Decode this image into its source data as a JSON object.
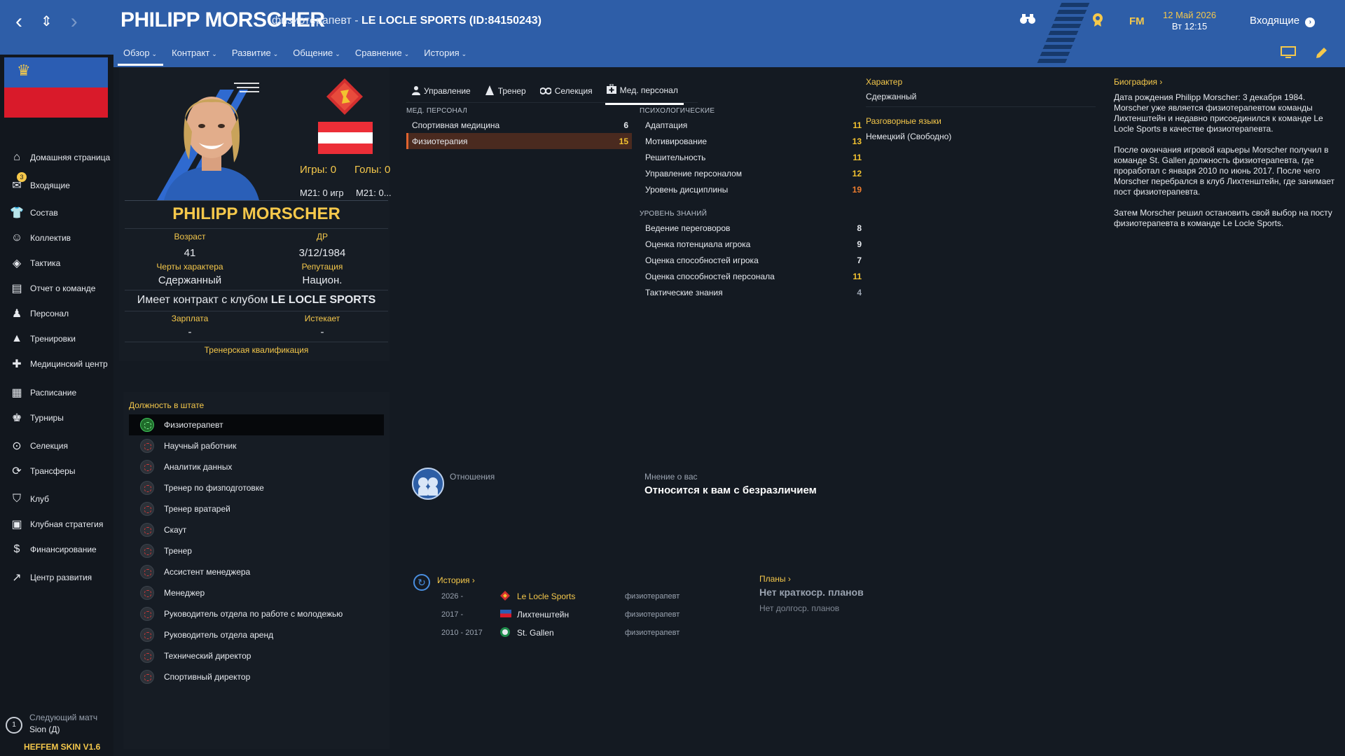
{
  "header": {
    "nav": {
      "back": "‹",
      "updown": "⇕",
      "forward": "›"
    },
    "title": "PHILIPP MORSCHER",
    "subtitle_prefix": "физиотерапевт - ",
    "subtitle_club": "LE LOCLE SPORTS (ID:84150243)",
    "tabs": [
      "Обзор",
      "Контракт",
      "Развитие",
      "Общение",
      "Сравнение",
      "История"
    ],
    "date_line1": "12 Май 2026",
    "date_line2": "Вт 12:15",
    "fm_label": "FM",
    "inbox_label": "Входящие"
  },
  "sidebar": {
    "inbox_badge": "3",
    "items": [
      {
        "label": "Домашняя страница",
        "icon": "home-icon"
      },
      {
        "label": "Входящие",
        "icon": "inbox-icon"
      },
      {
        "label": "Состав",
        "icon": "shirt-icon"
      },
      {
        "label": "Коллектив",
        "icon": "brain-icon"
      },
      {
        "label": "Тактика",
        "icon": "tactics-icon"
      },
      {
        "label": "Отчет о команде",
        "icon": "report-icon"
      },
      {
        "label": "Персонал",
        "icon": "staff-icon"
      },
      {
        "label": "Тренировки",
        "icon": "cone-icon"
      },
      {
        "label": "Медицинский центр",
        "icon": "medical-icon"
      },
      {
        "label": "Расписание",
        "icon": "calendar-icon"
      },
      {
        "label": "Турниры",
        "icon": "trophy-icon"
      },
      {
        "label": "Селекция",
        "icon": "binoculars-icon"
      },
      {
        "label": "Трансферы",
        "icon": "transfer-icon"
      },
      {
        "label": "Клуб",
        "icon": "shield-icon"
      },
      {
        "label": "Клубная стратегия",
        "icon": "briefcase-icon"
      },
      {
        "label": "Финансирование",
        "icon": "money-icon"
      },
      {
        "label": "Центр развития",
        "icon": "growth-icon"
      }
    ],
    "next_match_number": "1",
    "next_match_label": "Следующий матч",
    "next_match_opponent": "Sion (Д)",
    "skin_label": "HEFFEM SKIN V1.6"
  },
  "profile": {
    "games_label": "Игры: 0",
    "goals_label": "Голы: 0",
    "m1": "М21: 0 игр",
    "m2": "М21: 0...",
    "name": "PHILIPP MORSCHER",
    "age_label": "Возраст",
    "age": "41",
    "dob_label": "ДР",
    "dob": "3/12/1984",
    "traits_label": "Черты характера",
    "traits": "Сдержанный",
    "rep_label": "Репутация",
    "rep": "Национ.",
    "contract_prefix": "Имеет контракт с клубом ",
    "contract_club": "LE LOCLE SPORTS",
    "wage_label": "Зарплата",
    "wage": "-",
    "expires_label": "Истекает",
    "expires": "-",
    "coaching_qual": "Тренерская квалификация"
  },
  "staff_roles": {
    "title": "Должность в штате",
    "roles": [
      "Физиотерапевт",
      "Научный работник",
      "Аналитик данных",
      "Тренер по физподготовке",
      "Тренер вратарей",
      "Скаут",
      "Тренер",
      "Ассистент менеджера",
      "Менеджер",
      "Руководитель отдела по работе с молодежью",
      "Руководитель отдела аренд",
      "Технический директор",
      "Спортивный директор"
    ],
    "selected": 0
  },
  "subtabs": [
    "Управление",
    "Тренер",
    "Селекция",
    "Мед. персонал"
  ],
  "medical": {
    "title": "МЕД. ПЕРСОНАЛ",
    "attrs": [
      {
        "name": "Спортивная медицина",
        "value": "6",
        "color": "white"
      },
      {
        "name": "Физиотерапия",
        "value": "15",
        "color": "yellow",
        "highlight": true
      }
    ]
  },
  "psych": {
    "title": "ПСИХОЛОГИЧЕСКИЕ",
    "attrs": [
      {
        "name": "Адаптация",
        "value": "11",
        "color": "yellow"
      },
      {
        "name": "Мотивирование",
        "value": "13",
        "color": "yellow"
      },
      {
        "name": "Решительность",
        "value": "11",
        "color": "yellow"
      },
      {
        "name": "Управление персоналом",
        "value": "12",
        "color": "yellow"
      },
      {
        "name": "Уровень дисциплины",
        "value": "19",
        "color": "orange"
      }
    ]
  },
  "knowledge": {
    "title": "УРОВЕНЬ ЗНАНИЙ",
    "attrs": [
      {
        "name": "Ведение переговоров",
        "value": "8",
        "color": "white"
      },
      {
        "name": "Оценка потенциала игрока",
        "value": "9",
        "color": "white"
      },
      {
        "name": "Оценка способностей игрока",
        "value": "7",
        "color": "white"
      },
      {
        "name": "Оценка способностей персонала",
        "value": "11",
        "color": "yellow"
      },
      {
        "name": "Тактические знания",
        "value": "4",
        "color": "grey"
      }
    ]
  },
  "character": {
    "label": "Характер",
    "value": "Сдержанный",
    "languages_label": "Разговорные языки",
    "languages": "Немецкий (Свободно)"
  },
  "relations": {
    "label": "Отношения",
    "opinion_label": "Мнение о вас",
    "opinion": "Относится к вам с безразличием"
  },
  "history": {
    "title": "История",
    "rows": [
      {
        "years": "2026 -",
        "club": "Le Locle Sports",
        "role": "физиотерапевт",
        "highlight": true,
        "icon": "le-locle-badge-icon"
      },
      {
        "years": "2017 -",
        "club": "Лихтенштейн",
        "role": "физиотерапевт",
        "highlight": false,
        "icon": "liechtenstein-flag-icon"
      },
      {
        "years": "2010 - 2017",
        "club": "St. Gallen",
        "role": "физиотерапевт",
        "highlight": false,
        "icon": "st-gallen-badge-icon"
      }
    ]
  },
  "plans": {
    "title": "Планы",
    "short": "Нет краткоср. планов",
    "long": "Нет долгоср. планов"
  },
  "bio": {
    "title": "Биография",
    "paragraphs": [
      "Дата рождения Philipp Morscher: 3 декабря 1984. Morscher уже является физиотерапевтом команды Лихтенштейн и недавно присоединился к команде Le Locle Sports в качестве физиотерапевта.",
      "После окончания игровой карьеры Morscher получил в команде St. Gallen должность физиотерапевта, где проработал с января 2010 по июнь 2017. После чего Morscher перебрался в клуб Лихтенштейн, где занимает пост физиотерапевта.",
      "Затем Morscher решил остановить свой выбор на посту физиотерапевта в команде Le Locle Sports."
    ]
  },
  "colors": {
    "accent_yellow": "#f5c84b",
    "topbar_blue": "#2e5ea8",
    "value_orange": "#ef7d2f",
    "highlight_row": "#4a2a1f"
  }
}
